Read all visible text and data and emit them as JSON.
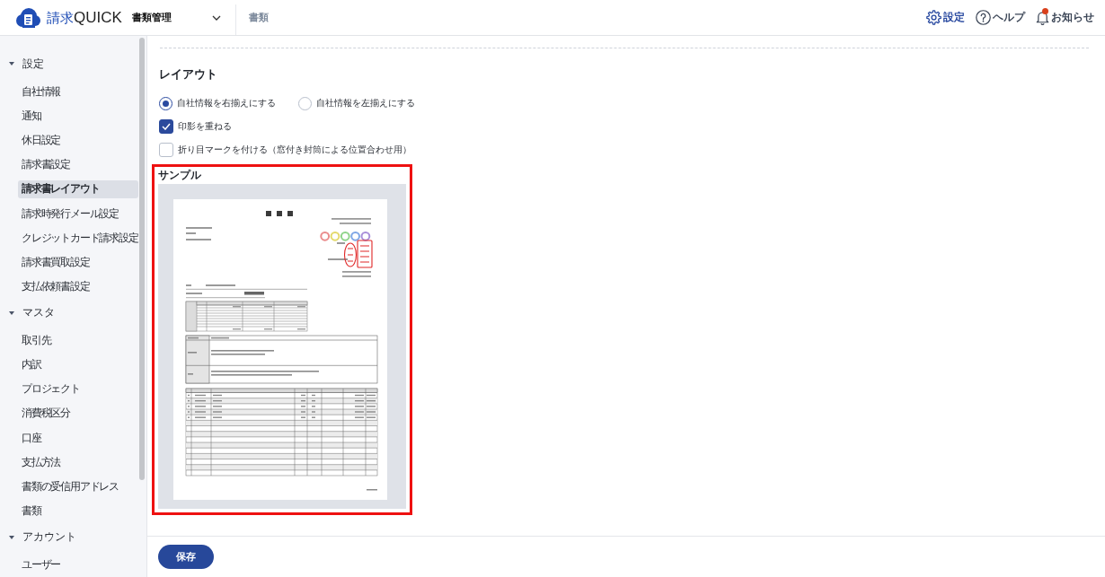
{
  "header": {
    "logo": {
      "text_primary": "請求",
      "text_secondary": "QUICK"
    },
    "module_menu": {
      "label": "書類管理",
      "expanded": false
    },
    "page_title": "書類",
    "actions": [
      {
        "kind": "settings",
        "label": "設定"
      },
      {
        "kind": "help",
        "label": "ヘルプ"
      },
      {
        "kind": "notifications",
        "label": "お知らせ",
        "unread": true
      }
    ]
  },
  "sidebar": {
    "sections": [
      {
        "title": "設定",
        "expanded": true,
        "items": [
          {
            "label": "自社情報",
            "selected": false
          },
          {
            "label": "通知",
            "selected": false
          },
          {
            "label": "休日設定",
            "selected": false
          },
          {
            "label": "請求書設定",
            "selected": false
          },
          {
            "label": "請求書レイアウト",
            "selected": true
          },
          {
            "label": "請求時発行メール設定",
            "selected": false
          },
          {
            "label": "クレジットカード請求設定",
            "selected": false
          },
          {
            "label": "請求書買取設定",
            "selected": false
          },
          {
            "label": "支払依頼書設定",
            "selected": false
          }
        ]
      },
      {
        "title": "マスタ",
        "expanded": true,
        "items": [
          {
            "label": "取引先",
            "selected": false
          },
          {
            "label": "内訳",
            "selected": false
          },
          {
            "label": "プロジェクト",
            "selected": false
          },
          {
            "label": "消費税区分",
            "selected": false
          },
          {
            "label": "口座",
            "selected": false
          },
          {
            "label": "支払方法",
            "selected": false
          },
          {
            "label": "書類の受信用アドレス",
            "selected": false
          },
          {
            "label": "書類",
            "selected": false
          }
        ]
      },
      {
        "title": "アカウント",
        "expanded": true,
        "items": [
          {
            "label": "ユーザー",
            "selected": false
          }
        ]
      }
    ]
  },
  "content": {
    "section_title": "レイアウト",
    "alignment_options": [
      {
        "label": "自社情報を右揃えにする",
        "selected": true
      },
      {
        "label": "自社情報を左揃えにする",
        "selected": false
      }
    ],
    "checkboxes": [
      {
        "label": "印影を重ねる",
        "checked": true
      },
      {
        "label": "折り目マークを付ける（窓付き封筒による位置合わせ用）",
        "checked": false
      }
    ],
    "sample": {
      "label": "サンプル",
      "highlighted": true
    }
  },
  "footer": {
    "save_button": "保存"
  }
}
